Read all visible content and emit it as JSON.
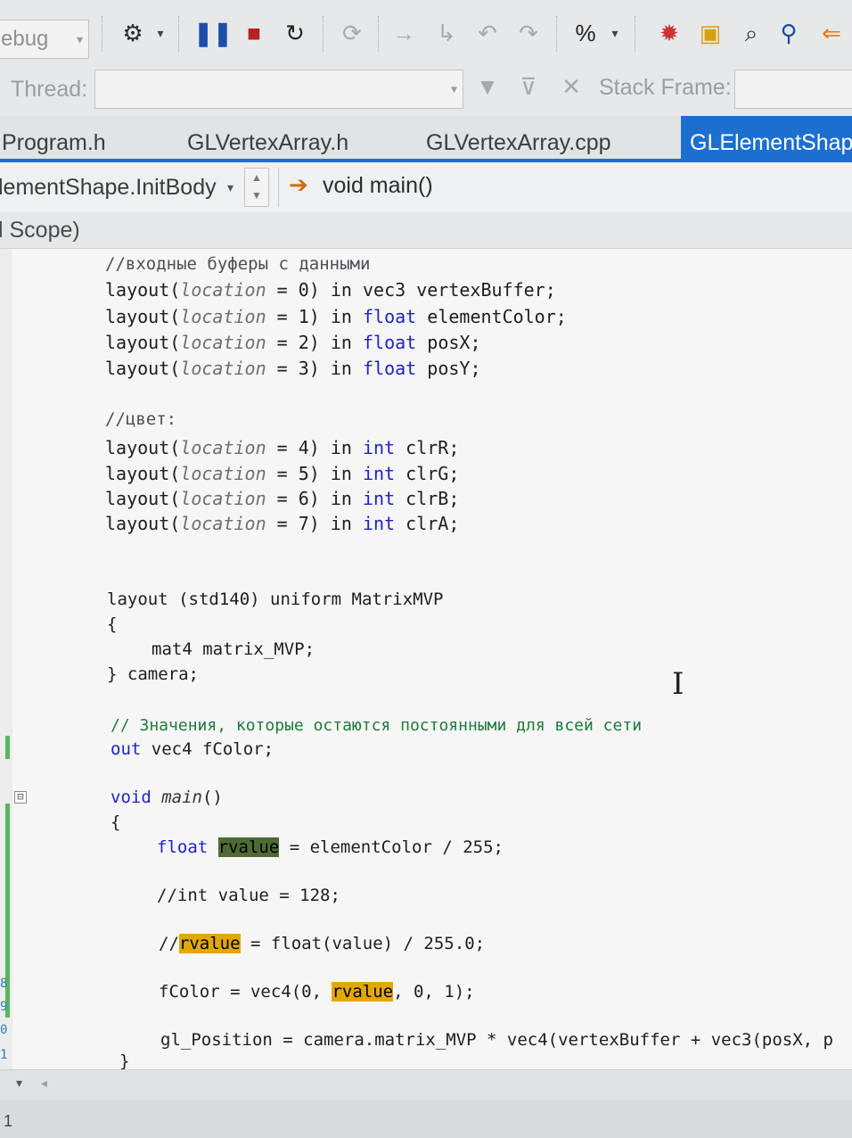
{
  "toolbar": {
    "config_combo": "ebug",
    "icons": [
      "process-icon",
      "pause-icon",
      "stop-icon",
      "restart-icon",
      "show-next-statement-icon",
      "step-into-icon",
      "step-over-icon",
      "step-out-icon",
      "breakpoints-icon",
      "settings-icon",
      "toolbox-icon",
      "find-icon",
      "search-icon",
      "navigate-back-icon"
    ],
    "colors": {
      "pause": "#1c4fa8",
      "stop": "#b4231f",
      "restart": "#222222",
      "disabled": "#a8a9ad"
    }
  },
  "threadbar": {
    "thread_label": "Thread:",
    "stack_frame_label": "Stack Frame:"
  },
  "tabs": [
    {
      "label": "Program.h",
      "active": false
    },
    {
      "label": "GLVertexArray.h",
      "active": false
    },
    {
      "label": "GLVertexArray.cpp",
      "active": false
    },
    {
      "label": "GLElementShape",
      "active": true
    }
  ],
  "navbar": {
    "class_combo": "lementShape.InitBody",
    "member_label": "void main()",
    "scope_label": "l Scope)"
  },
  "code": {
    "l01": "//входные буферы с данными",
    "layout": "layout(",
    "location": "location",
    "in": "in",
    "vec3": "vec3",
    "float": "float",
    "int": "int",
    "l02_a": " = 0) ",
    "l02_b": " vertexBuffer;",
    "l03_a": " = 1) ",
    "l03_b": " elementColor;",
    "l04_a": " = 2) ",
    "l04_b": " posX;",
    "l05_a": " = 3) ",
    "l05_b": " posY;",
    "l06": "//цвет:",
    "l07_a": " = 4) ",
    "l07_b": " clrR;",
    "l08_a": " = 5) ",
    "l08_b": " clrG;",
    "l09_a": " = 6) ",
    "l09_b": " clrB;",
    "l10_a": " = 7) ",
    "l10_b": " clrA;",
    "l11": "layout (std140) uniform MatrixMVP",
    "l12": "{",
    "l13": "mat4 matrix_MVP;",
    "l14": "} camera;",
    "l15": "// Значения, которые остаются постоянными для всей сети",
    "l16_kw": "out",
    "l16_b": " vec4 fColor;",
    "l17_kw": "void",
    "l17_fn": "main",
    "l17_b": "()",
    "l18": "{",
    "l19_b": "rvalue",
    "l19_c": " = elementColor / 255;",
    "l20": "//int value = 128;",
    "l21_a": "//",
    "l21_b": "rvalue",
    "l21_c": " = float(value) / 255.0;",
    "l22_a": "fColor = vec4(0, ",
    "l22_b": "rvalue",
    "l22_c": ", 0, 1);",
    "l23": "gl_Position = camera.matrix_MVP * vec4(vertexBuffer + vec3(posX, p",
    "l24": "}"
  },
  "line_numbers": [
    "8",
    "9",
    "0",
    "1"
  ],
  "fold_glyph": "⊟",
  "status": {
    "line_prefix": "1"
  }
}
